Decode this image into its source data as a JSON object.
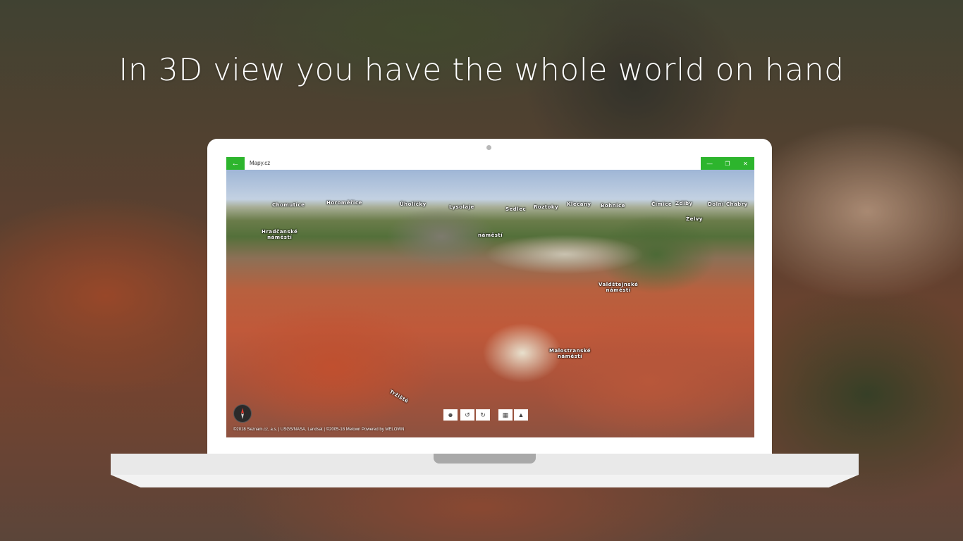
{
  "headline": "In 3D view you have the whole world on hand",
  "window": {
    "title": "Mapy.cz",
    "back_icon": "arrow-left-icon",
    "minimize_glyph": "—",
    "maximize_glyph": "❐",
    "close_glyph": "✕",
    "accent_color": "#2db52d"
  },
  "map": {
    "labels": {
      "chomutice": "Chomutice",
      "horomerice": "Horoměřice",
      "uholicky": "Úholičky",
      "lysolaje": "Lysolaje",
      "sedlec": "Sedlec",
      "roztoky": "Roztoky",
      "klecany": "Klecany",
      "bohnice": "Bohnice",
      "cimice": "Čimice",
      "zdiby": "Zdiby",
      "dolni_chabry": "Dolní Chabry",
      "zelvy": "Želvy",
      "hradcanske": "Hradčanské",
      "namesti_1": "náměstí",
      "namesti_2": "náměstí",
      "valdstejnske": "Valdštejnské",
      "namesti_3": "náměstí",
      "malostranske": "Malostranské",
      "namesti_4": "náměstí",
      "trziste": "Tržiště"
    },
    "controls": {
      "tilt_icon": "person-3d-icon",
      "rotate_left_icon": "rotate-left-icon",
      "rotate_right_icon": "rotate-right-icon",
      "layers_icon": "grid-icon",
      "terrain_icon": "terrain-icon"
    },
    "copyright": "©2018 Seznam.cz, a.s. | USGS/NASA, Landsat | ©2005-18 Melown Powered by MELOWN"
  }
}
